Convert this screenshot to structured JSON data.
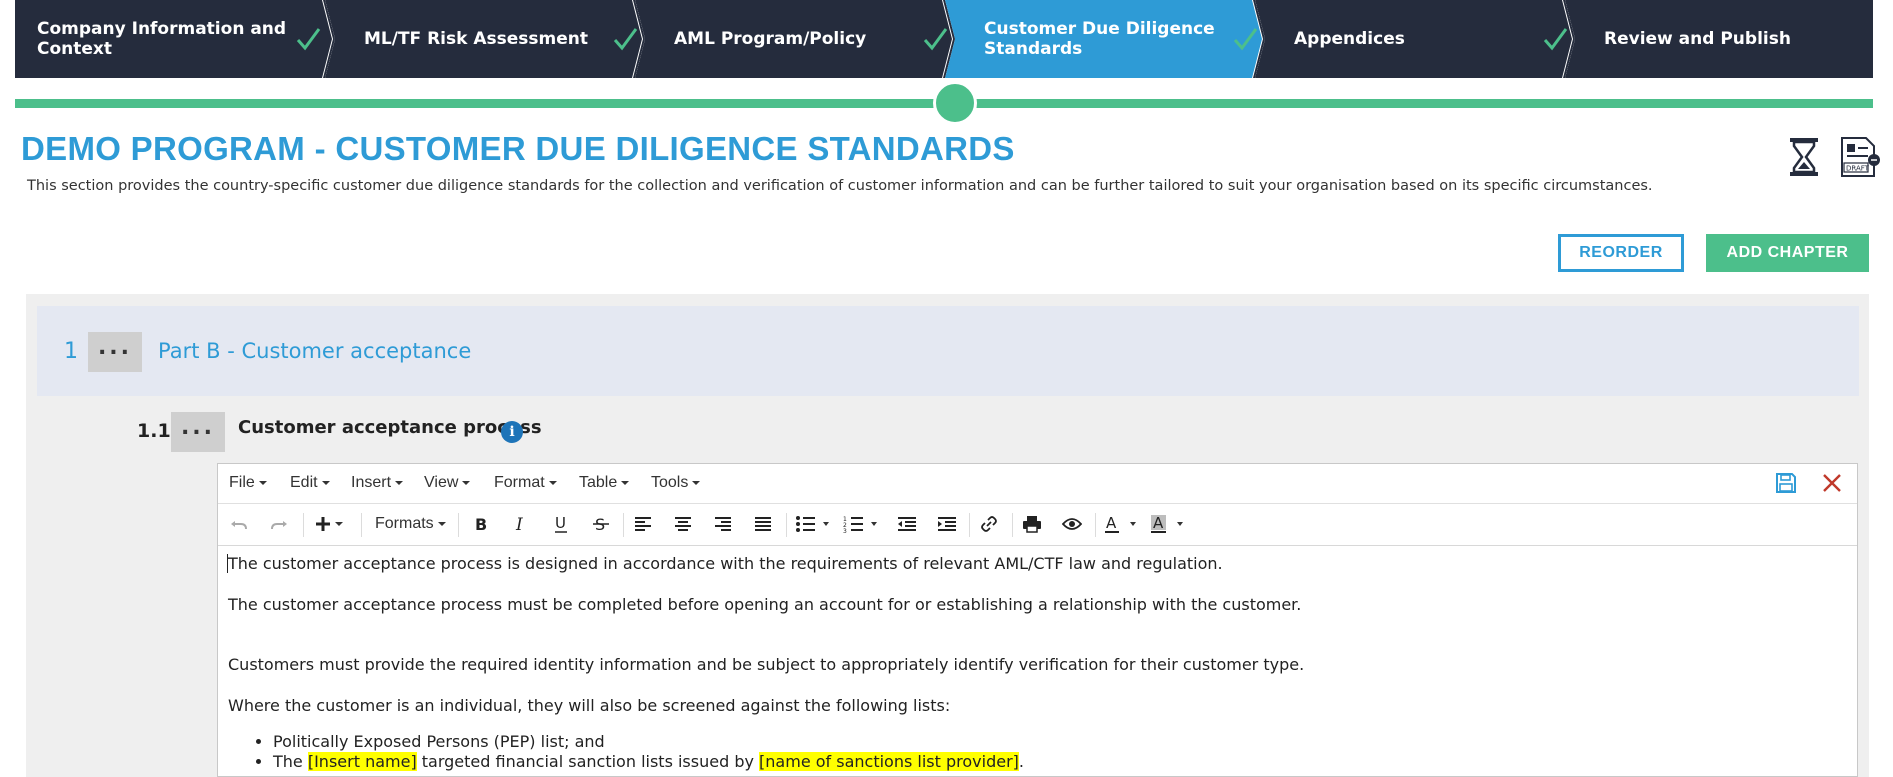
{
  "stepper": {
    "steps": [
      {
        "label_line1": "Company Information and",
        "label_line2": "Context",
        "completed": true
      },
      {
        "label": "ML/TF Risk Assessment",
        "completed": true
      },
      {
        "label": "AML Program/Policy",
        "completed": true
      },
      {
        "label_line1": "Customer Due Diligence",
        "label_line2": "Standards",
        "completed": true,
        "active": true
      },
      {
        "label": "Appendices",
        "completed": true
      },
      {
        "label": "Review and Publish",
        "completed": false
      }
    ],
    "colors": {
      "bar": "#252c3d",
      "active": "#2e9bd6",
      "check": "#4cbf8b",
      "progress": "#4cbf8b"
    }
  },
  "header": {
    "title": "DEMO PROGRAM - CUSTOMER DUE DILIGENCE STANDARDS",
    "description": "This section provides the country-specific customer due diligence standards for the collection and verification of customer information and can be further tailored to suit your organisation based on its specific circumstances.",
    "icons": [
      "hourglass-icon",
      "draft-document-icon"
    ]
  },
  "actions": {
    "reorder_label": "REORDER",
    "add_chapter_label": "ADD CHAPTER"
  },
  "chapter": {
    "number": "1",
    "menu_label": "...",
    "title": "Part B - Customer acceptance"
  },
  "section": {
    "number": "1.1",
    "menu_label": "...",
    "title": "Customer acceptance process",
    "info_label": "i"
  },
  "editor": {
    "menus": [
      "File",
      "Edit",
      "Insert",
      "View",
      "Format",
      "Table",
      "Tools"
    ],
    "formats_label": "Formats",
    "toolbar_icons": [
      "undo-icon",
      "redo-icon",
      "insert-plus-icon",
      "bold-icon",
      "italic-icon",
      "underline-icon",
      "strikethrough-icon",
      "align-left-icon",
      "align-center-icon",
      "align-right-icon",
      "align-justify-icon",
      "bullet-list-icon",
      "numbered-list-icon",
      "outdent-icon",
      "indent-icon",
      "link-icon",
      "print-icon",
      "preview-icon",
      "text-color-icon",
      "background-color-icon"
    ],
    "paragraphs": [
      "The customer acceptance process is designed in accordance with the requirements of relevant AML/CTF law and regulation.",
      "The customer acceptance process must be completed before opening an account for or establishing a relationship with the customer.",
      "Customers must provide the required identity information and be subject to appropriately identify verification for their customer type.",
      "Where the customer is an individual, they will also be screened against the following lists:"
    ],
    "bullets": {
      "item1": "Politically Exposed Persons (PEP) list; and",
      "item2_part1": "The ",
      "item2_highlight1": "[Insert name]",
      "item2_part2": " targeted financial sanction lists issued by ",
      "item2_highlight2": "[name of sanctions list provider]",
      "item2_part3": "."
    },
    "highlight_color": "#ffff00"
  }
}
